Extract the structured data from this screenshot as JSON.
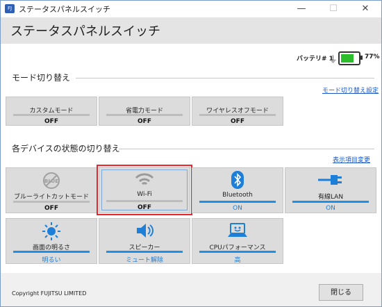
{
  "window": {
    "title": "ステータスパネルスイッチ",
    "app_icon_text": "FJ"
  },
  "header": {
    "title": "ステータスパネルスイッチ"
  },
  "battery": {
    "label": "バッテリ# 1",
    "percent_text": "77%",
    "level": 0.77,
    "color": "#2bbd2b"
  },
  "mode_section": {
    "title": "モード切り替え",
    "link": "モード切り替え設定",
    "tiles": [
      {
        "name": "カスタムモード",
        "value": "OFF"
      },
      {
        "name": "省電力モード",
        "value": "OFF"
      },
      {
        "name": "ワイヤレスオフモード",
        "value": "OFF"
      }
    ]
  },
  "device_section": {
    "title": "各デバイスの状態の切り替え",
    "link": "表示項目変更",
    "tiles": [
      {
        "name": "ブルーライトカットモード",
        "value": "OFF",
        "icon": "blue-light-icon",
        "icon_text": "BLUE",
        "state": "off"
      },
      {
        "name": "Wi-Fi",
        "value": "OFF",
        "icon": "wifi-icon",
        "state": "off",
        "selected": true
      },
      {
        "name": "Bluetooth",
        "value": "ON",
        "icon": "bluetooth-icon",
        "state": "on"
      },
      {
        "name": "有線LAN",
        "value": "ON",
        "icon": "lan-icon",
        "state": "on"
      },
      {
        "name": "画面の明るさ",
        "value": "明るい",
        "icon": "brightness-icon",
        "state": "on"
      },
      {
        "name": "スピーカー",
        "value": "ミュート解除",
        "icon": "speaker-icon",
        "state": "on"
      },
      {
        "name": "CPUパフォーマンス",
        "value": "高",
        "icon": "cpu-performance-icon",
        "state": "on"
      }
    ]
  },
  "footer": {
    "copyright": "Copyright FUJITSU LIMITED",
    "close_label": "閉じる"
  },
  "colors": {
    "accent": "#1e90e8",
    "selection": "#e8242c",
    "link": "#1a56c8"
  }
}
